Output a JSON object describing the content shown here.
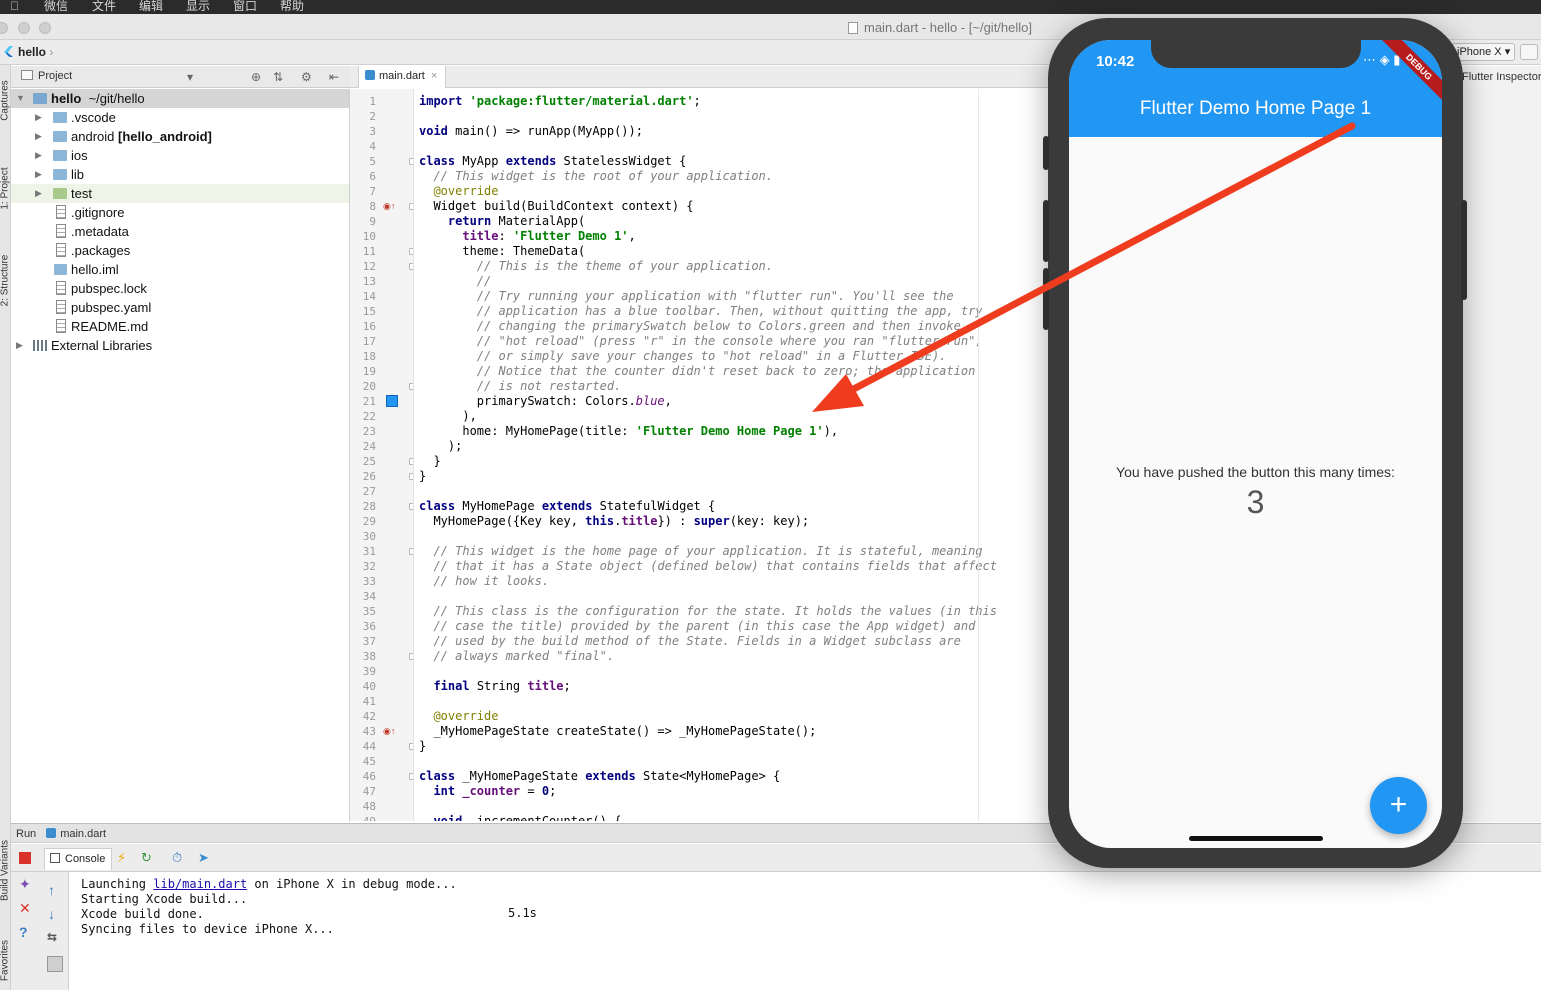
{
  "menubar": {
    "items": [
      "微信",
      "文件",
      "编辑",
      "显示",
      "窗口",
      "帮助"
    ]
  },
  "window": {
    "title": "main.dart - hello - [~/git/hello]"
  },
  "navbar": {
    "crumb": "hello",
    "device": "iPhone X"
  },
  "left_strip": {
    "labels": [
      "Captures",
      "1: Project",
      "2: Structure",
      "Build Variants",
      "Favorites"
    ]
  },
  "project": {
    "header": "Project",
    "tree": [
      {
        "name": "hello",
        "suffix": "~/git/hello",
        "type": "root"
      },
      {
        "name": ".vscode",
        "type": "folder"
      },
      {
        "name": "android",
        "suffix": "[hello_android]",
        "type": "folder"
      },
      {
        "name": "ios",
        "type": "folder"
      },
      {
        "name": "lib",
        "type": "folder"
      },
      {
        "name": "test",
        "type": "folder"
      },
      {
        "name": ".gitignore",
        "type": "file"
      },
      {
        "name": ".metadata",
        "type": "file"
      },
      {
        "name": ".packages",
        "type": "file"
      },
      {
        "name": "hello.iml",
        "type": "file"
      },
      {
        "name": "pubspec.lock",
        "type": "file"
      },
      {
        "name": "pubspec.yaml",
        "type": "file"
      },
      {
        "name": "README.md",
        "type": "file"
      },
      {
        "name": "External Libraries",
        "type": "libs"
      }
    ]
  },
  "editor": {
    "tab": "main.dart",
    "lines": [
      [
        [
          "kw",
          "import "
        ],
        [
          "str",
          "'package:flutter/material.dart'"
        ],
        [
          "t",
          ";"
        ]
      ],
      [],
      [
        [
          "kw",
          "void "
        ],
        [
          "t",
          "main() => runApp(MyApp());"
        ]
      ],
      [],
      [
        [
          "kw",
          "class "
        ],
        [
          "t",
          "MyApp "
        ],
        [
          "kw",
          "extends "
        ],
        [
          "t",
          "StatelessWidget {"
        ]
      ],
      [
        [
          "t",
          "  "
        ],
        [
          "cm",
          "// This widget is the root of your application."
        ]
      ],
      [
        [
          "t",
          "  "
        ],
        [
          "an",
          "@override"
        ]
      ],
      [
        [
          "t",
          "  Widget build(BuildContext context) {"
        ]
      ],
      [
        [
          "t",
          "    "
        ],
        [
          "kw",
          "return "
        ],
        [
          "t",
          "MaterialApp("
        ]
      ],
      [
        [
          "t",
          "      "
        ],
        [
          "fld",
          "title"
        ],
        [
          "t",
          ": "
        ],
        [
          "str",
          "'Flutter Demo 1'"
        ],
        [
          "t",
          ","
        ]
      ],
      [
        [
          "t",
          "      theme: ThemeData("
        ]
      ],
      [
        [
          "t",
          "        "
        ],
        [
          "cm",
          "// This is the theme of your application."
        ]
      ],
      [
        [
          "t",
          "        "
        ],
        [
          "cm",
          "//"
        ]
      ],
      [
        [
          "t",
          "        "
        ],
        [
          "cm",
          "// Try running your application with \"flutter run\". You'll see the"
        ]
      ],
      [
        [
          "t",
          "        "
        ],
        [
          "cm",
          "// application has a blue toolbar. Then, without quitting the app, try"
        ]
      ],
      [
        [
          "t",
          "        "
        ],
        [
          "cm",
          "// changing the primarySwatch below to Colors.green and then invoke"
        ]
      ],
      [
        [
          "t",
          "        "
        ],
        [
          "cm",
          "// \"hot reload\" (press \"r\" in the console where you ran \"flutter run\","
        ]
      ],
      [
        [
          "t",
          "        "
        ],
        [
          "cm",
          "// or simply save your changes to \"hot reload\" in a Flutter IDE)."
        ]
      ],
      [
        [
          "t",
          "        "
        ],
        [
          "cm",
          "// Notice that the counter didn't reset back to zero; the application"
        ]
      ],
      [
        [
          "t",
          "        "
        ],
        [
          "cm",
          "// is not restarted."
        ]
      ],
      [
        [
          "t",
          "        primarySwatch: Colors."
        ],
        [
          "fi",
          "blue"
        ],
        [
          "t",
          ","
        ]
      ],
      [
        [
          "t",
          "      ),"
        ]
      ],
      [
        [
          "t",
          "      home: MyHomePage(title: "
        ],
        [
          "str",
          "'Flutter Demo Home Page 1'"
        ],
        [
          "t",
          "),"
        ]
      ],
      [
        [
          "t",
          "    );"
        ]
      ],
      [
        [
          "t",
          "  }"
        ]
      ],
      [
        [
          "t",
          "}"
        ]
      ],
      [],
      [
        [
          "kw",
          "class "
        ],
        [
          "t",
          "MyHomePage "
        ],
        [
          "kw",
          "extends "
        ],
        [
          "t",
          "StatefulWidget {"
        ]
      ],
      [
        [
          "t",
          "  MyHomePage({Key key, "
        ],
        [
          "kw",
          "this"
        ],
        [
          "t",
          "."
        ],
        [
          "fld",
          "title"
        ],
        [
          "t",
          "}) : "
        ],
        [
          "kw",
          "super"
        ],
        [
          "t",
          "(key: key);"
        ]
      ],
      [],
      [
        [
          "t",
          "  "
        ],
        [
          "cm",
          "// This widget is the home page of your application. It is stateful, meaning"
        ]
      ],
      [
        [
          "t",
          "  "
        ],
        [
          "cm",
          "// that it has a State object (defined below) that contains fields that affect"
        ]
      ],
      [
        [
          "t",
          "  "
        ],
        [
          "cm",
          "// how it looks."
        ]
      ],
      [],
      [
        [
          "t",
          "  "
        ],
        [
          "cm",
          "// This class is the configuration for the state. It holds the values (in this"
        ]
      ],
      [
        [
          "t",
          "  "
        ],
        [
          "cm",
          "// case the title) provided by the parent (in this case the App widget) and"
        ]
      ],
      [
        [
          "t",
          "  "
        ],
        [
          "cm",
          "// used by the build method of the State. Fields in a Widget subclass are"
        ]
      ],
      [
        [
          "t",
          "  "
        ],
        [
          "cm",
          "// always marked \"final\"."
        ]
      ],
      [],
      [
        [
          "t",
          "  "
        ],
        [
          "kw",
          "final "
        ],
        [
          "t",
          "String "
        ],
        [
          "fld",
          "title"
        ],
        [
          "t",
          ";"
        ]
      ],
      [],
      [
        [
          "t",
          "  "
        ],
        [
          "an",
          "@override"
        ]
      ],
      [
        [
          "t",
          "  _MyHomePageState createState() => _MyHomePageState();"
        ]
      ],
      [
        [
          "t",
          "}"
        ]
      ],
      [],
      [
        [
          "kw",
          "class "
        ],
        [
          "t",
          "_MyHomePageState "
        ],
        [
          "kw",
          "extends "
        ],
        [
          "t",
          "State<MyHomePage> {"
        ]
      ],
      [
        [
          "t",
          "  "
        ],
        [
          "kw",
          "int "
        ],
        [
          "fld",
          "_counter "
        ],
        [
          "t",
          "= "
        ],
        [
          "kw",
          "0"
        ],
        [
          "t",
          ";"
        ]
      ],
      [],
      [
        [
          "t",
          "  "
        ],
        [
          "kw",
          "void "
        ],
        [
          "t",
          "_incrementCounter() {"
        ]
      ]
    ]
  },
  "run": {
    "title": "Run",
    "config": "main.dart",
    "console_tab": "Console",
    "log": {
      "line1_pre": "Launching ",
      "line1_link": "lib/main.dart",
      "line1_post": " on iPhone X in debug mode...",
      "line2": "Starting Xcode build...",
      "line3": "Xcode build done.",
      "line3_time": "5.1s",
      "line4": "Syncing files to device iPhone X..."
    }
  },
  "inspector": {
    "label": "Flutter Inspector:"
  },
  "simulator": {
    "time": "10:42",
    "debug": "DEBUG",
    "app_title": "Flutter Demo Home Page 1",
    "counter_label": "You have pushed the button this many times:",
    "counter_value": "3",
    "fab": "+",
    "primary_color": "#2196f3"
  },
  "annotation": {
    "arrow_color": "#f03c1e"
  }
}
